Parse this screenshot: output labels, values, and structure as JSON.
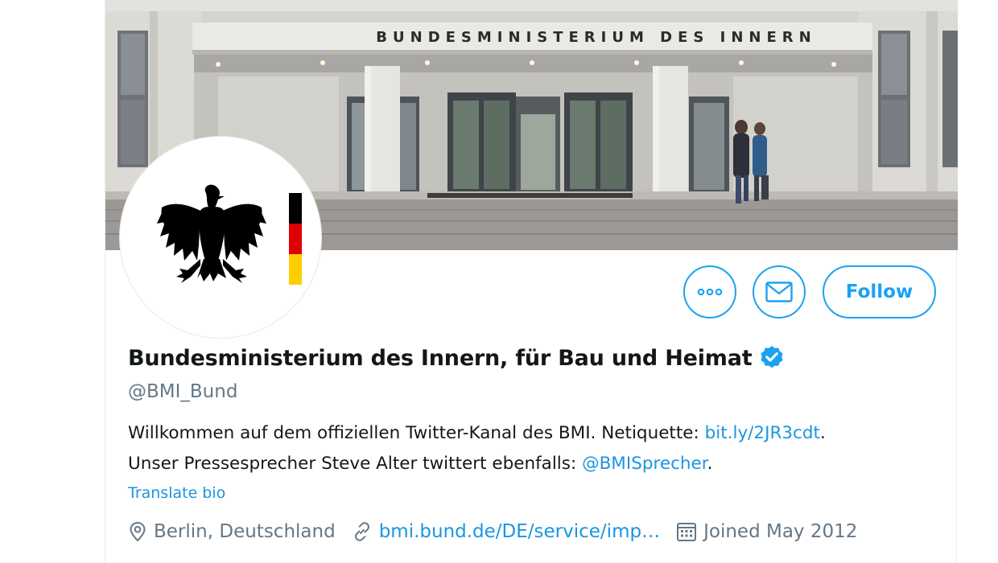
{
  "banner": {
    "building_sign": "BUNDESMINISTERIUM DES INNERN"
  },
  "actions": {
    "more_icon": "more-dots-icon",
    "message_icon": "envelope-icon",
    "follow_label": "Follow"
  },
  "profile": {
    "display_name": "Bundesministerium des Innern, für Bau und Heimat",
    "verified_icon": "verified-badge-icon",
    "handle": "@BMI_Bund",
    "bio": {
      "line1_text": "Willkommen auf dem offiziellen Twitter-Kanal des BMI. Netiquette: ",
      "line1_link": "bit.ly/2JR3cdt",
      "line1_end": ".",
      "line2_text": "Unser Pressesprecher Steve Alter twittert ebenfalls: ",
      "line2_link": "@BMISprecher",
      "line2_end": "."
    },
    "translate_label": "Translate bio",
    "location": "Berlin, Deutschland",
    "website": "bmi.bund.de/DE/service/imp…",
    "joined": "Joined May 2012"
  },
  "colors": {
    "accent": "#1da1f2",
    "link": "#1b95e0",
    "secondary_text": "#657786",
    "flag_black": "#000000",
    "flag_red": "#dd0000",
    "flag_gold": "#ffce00"
  }
}
